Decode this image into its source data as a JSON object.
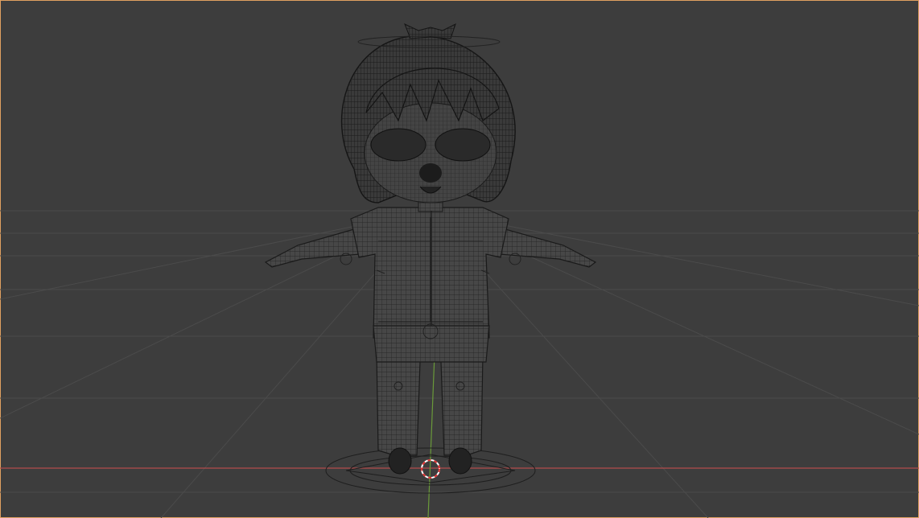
{
  "viewport": {
    "mode": "wireframe",
    "colors": {
      "background": "#3d3d3d",
      "grid_line": "#4a4a4a",
      "x_axis": "#b34c4c",
      "y_axis": "#6a9a3a",
      "wire": "#1f1f1f",
      "rig": "#2a2a2a",
      "cursor_red": "#e03030",
      "cursor_white": "#ffffff",
      "frame_border": "#e0a060"
    },
    "objects": [
      "character-mesh",
      "armature",
      "root-control",
      "3d-cursor"
    ]
  }
}
